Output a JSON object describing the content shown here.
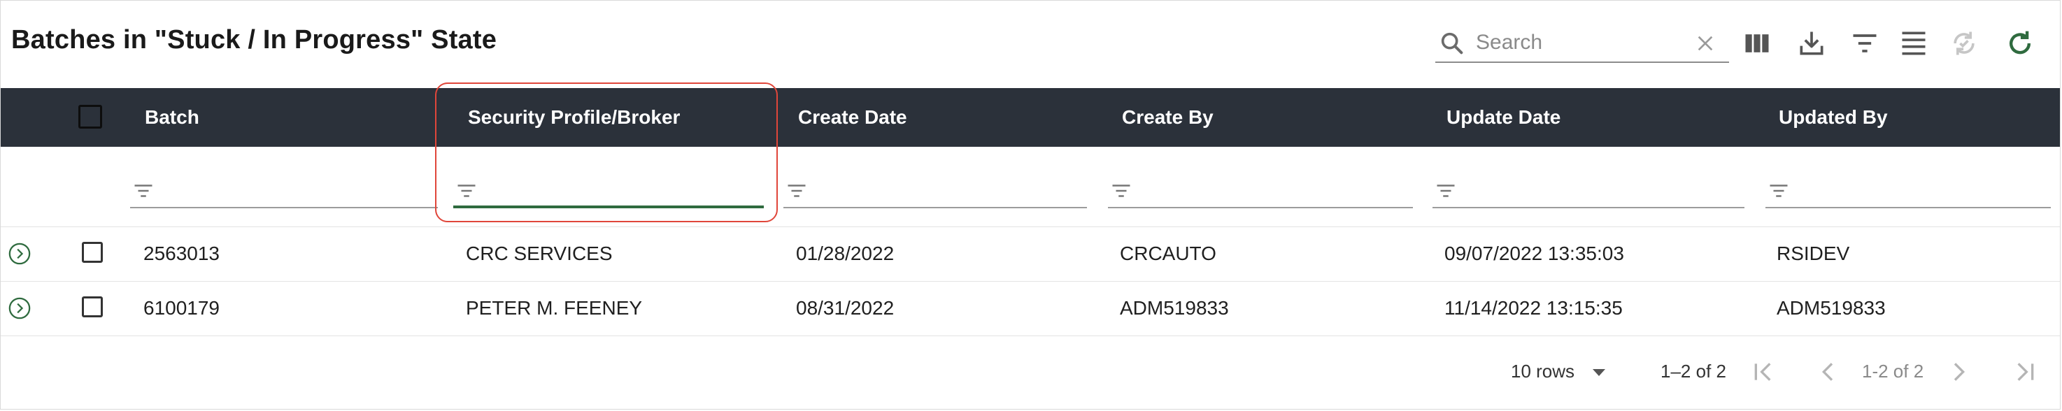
{
  "title": "Batches in \"Stuck / In Progress\" State",
  "toolbar": {
    "search_placeholder": "Search",
    "icons": [
      "search-icon",
      "clear-icon",
      "columns-icon",
      "download-icon",
      "filter-icon",
      "density-icon",
      "sync-icon",
      "refresh-icon"
    ]
  },
  "colors": {
    "header_bg": "#2b313a",
    "accent_green": "#2f6b3f",
    "highlight_red": "#e0463a"
  },
  "table": {
    "columns": [
      "Batch",
      "Security Profile/Broker",
      "Create Date",
      "Create By",
      "Update Date",
      "Updated By"
    ],
    "active_filter_column": "Security Profile/Broker",
    "rows": [
      {
        "batch": "2563013",
        "broker": "CRC SERVICES",
        "create_date": "01/28/2022",
        "create_by": "CRCAUTO",
        "update_date": "09/07/2022 13:35:03",
        "updated_by": "RSIDEV"
      },
      {
        "batch": "6100179",
        "broker": "PETER M. FEENEY",
        "create_date": "08/31/2022",
        "create_by": "ADM519833",
        "update_date": "11/14/2022 13:15:35",
        "updated_by": "ADM519833"
      }
    ]
  },
  "pagination": {
    "rows_per_page": "10 rows",
    "range": "1–2 of 2",
    "page_info": "1-2 of 2"
  }
}
